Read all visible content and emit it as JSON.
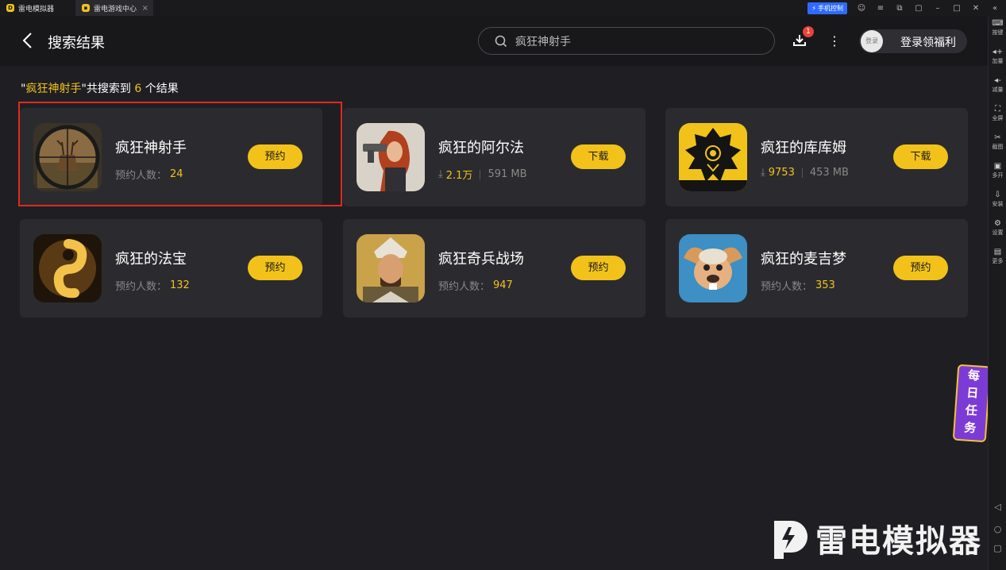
{
  "titlebar": {
    "tabs": [
      {
        "label": "雷电模拟器"
      },
      {
        "label": "雷电游戏中心"
      }
    ],
    "phone_control": "手机控制"
  },
  "sidebar": {
    "items": [
      {
        "label": "按键",
        "icon": "keyboard-icon"
      },
      {
        "label": "加量",
        "icon": "volume-up-icon"
      },
      {
        "label": "减量",
        "icon": "volume-down-icon"
      },
      {
        "label": "全屏",
        "icon": "fullscreen-icon"
      },
      {
        "label": "截图",
        "icon": "scissors-icon"
      },
      {
        "label": "多开",
        "icon": "multi-instance-icon"
      },
      {
        "label": "安装",
        "icon": "install-icon"
      },
      {
        "label": "设置",
        "icon": "gear-icon"
      },
      {
        "label": "更多",
        "icon": "more-icon"
      }
    ]
  },
  "header": {
    "title": "搜索结果",
    "search_value": "疯狂神射手",
    "download_badge": "1",
    "login_avatar": "登录",
    "login_label": "登录领福利"
  },
  "summary": {
    "open_quote": "\"",
    "query": "疯狂神射手",
    "mid": "\"共搜索到 ",
    "count": "6",
    "tail": " 个结果"
  },
  "results": [
    {
      "name": "疯狂神射手",
      "meta_label": "预约人数：",
      "meta_value": "24",
      "button": "预约"
    },
    {
      "name": "疯狂的阿尔法",
      "downloads": "2.1万",
      "size": "591 MB",
      "button": "下载"
    },
    {
      "name": "疯狂的库库姆",
      "downloads": "9753",
      "size": "453 MB",
      "button": "下载"
    },
    {
      "name": "疯狂的法宝",
      "meta_label": "预约人数：",
      "meta_value": "132",
      "button": "预约"
    },
    {
      "name": "疯狂奇兵战场",
      "meta_label": "预约人数：",
      "meta_value": "947",
      "button": "预约"
    },
    {
      "name": "疯狂的麦吉梦",
      "meta_label": "预约人数：",
      "meta_value": "353",
      "button": "预约"
    }
  ],
  "task_widget": [
    "每",
    "日",
    "任",
    "务"
  ],
  "watermark": "雷电模拟器",
  "colors": {
    "accent": "#f2c21b",
    "highlight": "#e3281e",
    "card_bg": "#2b2b2f",
    "page_bg": "#1f1f23"
  }
}
